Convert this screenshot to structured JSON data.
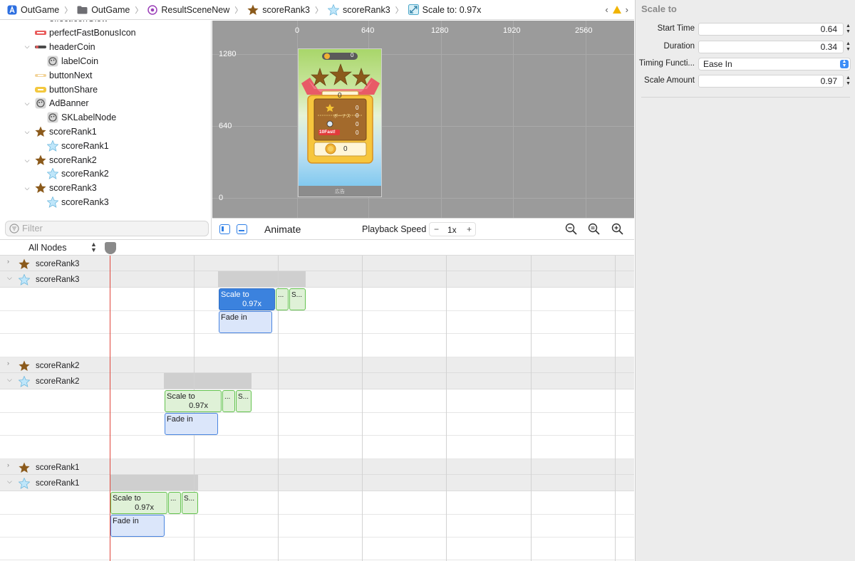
{
  "breadcrumb": [
    {
      "label": "OutGame",
      "icon": "xcode-project-icon"
    },
    {
      "label": "OutGame",
      "icon": "folder-icon"
    },
    {
      "label": "ResultSceneNew",
      "icon": "scene-file-icon"
    },
    {
      "label": "scoreRank3",
      "icon": "star-sprite-icon"
    },
    {
      "label": "scoreRank3",
      "icon": "light-star-sprite-icon"
    },
    {
      "label": "Scale to: 0.97x",
      "icon": "scale-action-icon"
    }
  ],
  "inspector": {
    "title": "Scale to",
    "start_time": {
      "label": "Start Time",
      "value": "0.64"
    },
    "duration": {
      "label": "Duration",
      "value": "0.34"
    },
    "timing_function": {
      "label": "Timing Functi...",
      "value": "Ease In"
    },
    "scale_amount": {
      "label": "Scale Amount",
      "value": "0.97"
    }
  },
  "scene_tree": {
    "items": [
      {
        "label": "effectIconGlow",
        "depth": 1,
        "icon": "sprite-icon",
        "expanded": null
      },
      {
        "label": "perfectFastBonusIcon",
        "depth": 1,
        "icon": "sprite-icon",
        "expanded": null
      },
      {
        "label": "headerCoin",
        "depth": 1,
        "icon": "sprite-icon",
        "expanded": true
      },
      {
        "label": "labelCoin",
        "depth": 2,
        "icon": "label-node-icon",
        "expanded": null
      },
      {
        "label": "buttonNext",
        "depth": 1,
        "icon": "sprite-icon",
        "expanded": null
      },
      {
        "label": "buttonShare",
        "depth": 1,
        "icon": "sprite-icon",
        "expanded": null
      },
      {
        "label": "AdBanner",
        "depth": 1,
        "icon": "label-node-icon",
        "expanded": true
      },
      {
        "label": "SKLabelNode",
        "depth": 2,
        "icon": "label-node-icon",
        "expanded": null
      },
      {
        "label": "scoreRank1",
        "depth": 1,
        "icon": "star-sprite-icon",
        "expanded": true
      },
      {
        "label": "scoreRank1",
        "depth": 2,
        "icon": "light-star-sprite-icon",
        "expanded": null
      },
      {
        "label": "scoreRank2",
        "depth": 1,
        "icon": "star-sprite-icon",
        "expanded": true
      },
      {
        "label": "scoreRank2",
        "depth": 2,
        "icon": "light-star-sprite-icon",
        "expanded": null
      },
      {
        "label": "scoreRank3",
        "depth": 1,
        "icon": "star-sprite-icon",
        "expanded": true
      },
      {
        "label": "scoreRank3",
        "depth": 2,
        "icon": "light-star-sprite-icon",
        "expanded": null
      }
    ],
    "filter_placeholder": "Filter"
  },
  "canvas": {
    "x_ruler": [
      "0",
      "640",
      "1280",
      "1920",
      "2560"
    ],
    "y_ruler": [
      "1280",
      "640",
      "0"
    ],
    "preview": {
      "top_coin_count": "0",
      "score": "0",
      "row_values": [
        "0",
        "0",
        "0",
        "0"
      ],
      "bonus_text": "ボーナス",
      "fast_text": "10Fast!",
      "coin_total": "0",
      "banner_text": "広告"
    }
  },
  "toolbar": {
    "animate_label": "Animate",
    "playback_speed_label": "Playback Speed",
    "decrement": "−",
    "speed_value": "1x",
    "increment": "+"
  },
  "timeline": {
    "filter_label": "All Nodes",
    "groups": [
      {
        "parent": {
          "label": "scoreRank3",
          "icon": "star-sprite-icon",
          "expanded": false
        },
        "child": {
          "label": "scoreRank3",
          "icon": "light-star-sprite-icon",
          "expanded": true
        },
        "actions": {
          "scale_label": "Scale to",
          "scale_value": "0.97x",
          "small1": "...",
          "small2": "S...",
          "fade_label": "Fade in",
          "selected": true
        }
      },
      {
        "parent": {
          "label": "scoreRank2",
          "icon": "star-sprite-icon",
          "expanded": false
        },
        "child": {
          "label": "scoreRank2",
          "icon": "light-star-sprite-icon",
          "expanded": true
        },
        "actions": {
          "scale_label": "Scale to",
          "scale_value": "0.97x",
          "small1": "...",
          "small2": "S...",
          "fade_label": "Fade in",
          "selected": false
        }
      },
      {
        "parent": {
          "label": "scoreRank1",
          "icon": "star-sprite-icon",
          "expanded": false
        },
        "child": {
          "label": "scoreRank1",
          "icon": "light-star-sprite-icon",
          "expanded": true
        },
        "actions": {
          "scale_label": "Scale to",
          "scale_value": "0.97x",
          "small1": "...",
          "small2": "S...",
          "fade_label": "Fade in",
          "selected": false
        }
      }
    ]
  },
  "colors": {
    "accent_blue": "#3b82de",
    "scale_action_green": "#63c24e",
    "fade_action_blue": "#4a85e0",
    "playhead_red": "#e0453a",
    "canvas_gray": "#9b9b9b",
    "warning_yellow": "#f1b400",
    "star_brown": "#8b5a1b",
    "star_light_blue": "#8fd3f4"
  }
}
